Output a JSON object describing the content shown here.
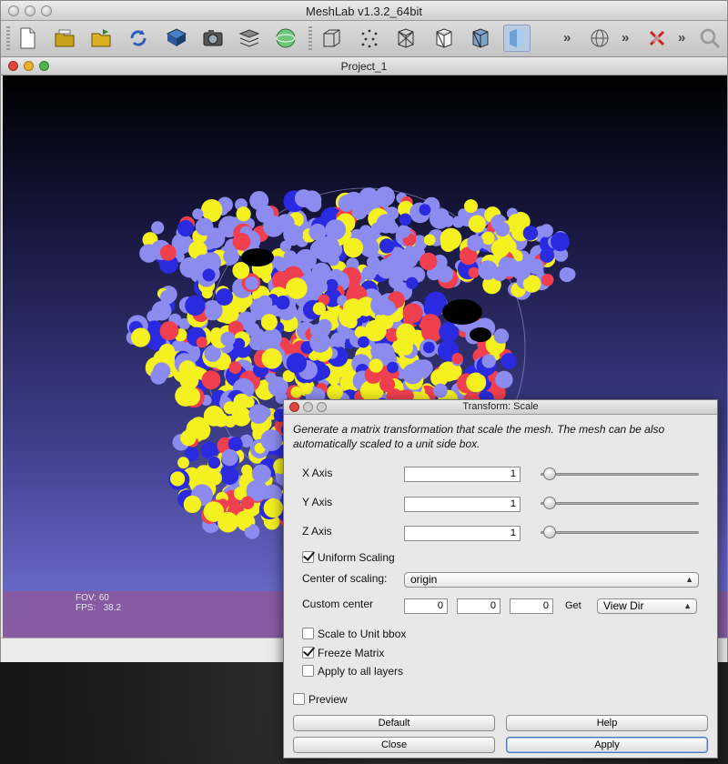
{
  "window": {
    "title": "MeshLab v1.3.2_64bit"
  },
  "toolbar": {
    "overflow_label": "»",
    "icons": [
      "new-document-icon",
      "open-project-icon",
      "open-folder-icon",
      "reload-icon",
      "save-disk-icon",
      "snapshot-camera-icon",
      "layers-icon",
      "color-sphere-icon",
      "bbox-icon",
      "points-icon",
      "wireframe-icon",
      "hidden-lines-icon",
      "flat-lines-icon",
      "flat-icon",
      "sphere-grid-icon",
      "no-color-icon",
      "search-icon"
    ]
  },
  "document": {
    "title": "Project_1"
  },
  "viewport": {
    "fov_label": "FOV:",
    "fov_value": "60",
    "fps_label": "FPS:",
    "fps_value": "38.2"
  },
  "dialog": {
    "title": "Transform: Scale",
    "description": "Generate a matrix transformation that scale the mesh. The mesh can be also automatically scaled to a unit side box.",
    "x_label": "X Axis",
    "x_value": "1",
    "y_label": "Y Axis",
    "y_value": "1",
    "z_label": "Z Axis",
    "z_value": "1",
    "uniform_label": "Uniform Scaling",
    "uniform_checked": true,
    "center_label": "Center of scaling:",
    "center_value": "origin",
    "custom_label": "Custom center",
    "custom_x": "0",
    "custom_y": "0",
    "custom_z": "0",
    "get_label": "Get",
    "viewdir_value": "View Dir",
    "unit_bbox_label": "Scale to Unit bbox",
    "unit_bbox_checked": false,
    "freeze_label": "Freeze Matrix",
    "freeze_checked": true,
    "all_layers_label": "Apply to all layers",
    "all_layers_checked": false,
    "preview_label": "Preview",
    "preview_checked": false,
    "default_btn": "Default",
    "help_btn": "Help",
    "close_btn": "Close",
    "apply_btn": "Apply"
  },
  "colors": {
    "atom_yellow": "#f5f020",
    "atom_blue": "#2a2ae0",
    "atom_red": "#f04050",
    "atom_lavender": "#8c8cf0",
    "info_bar": "#8a5aa0",
    "close_red": "#e0453d",
    "min_yellow": "#e8b22e",
    "max_green": "#4eb54a"
  }
}
